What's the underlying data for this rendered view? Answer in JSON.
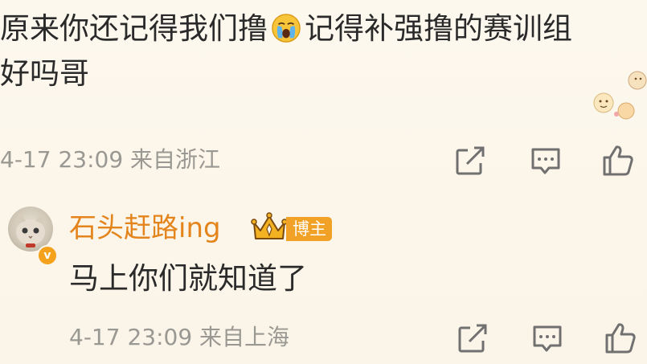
{
  "comment": {
    "line1_part1": "原来你还记得我们撸",
    "line1_part2": "记得补强撸的赛训组",
    "line2": "好吗哥",
    "emoji": "crying-face-icon"
  },
  "comment_meta": {
    "time_location": "4-17 23:09 来自浙江"
  },
  "reply": {
    "username": "石头赶路ing",
    "owner_badge": "博主",
    "verified_icon": "v-verified-icon",
    "text": "马上你们就知道了",
    "time_location": "4-17 23:09 来自上海"
  },
  "actions": [
    "share-icon",
    "comment-icon",
    "like-icon"
  ],
  "colors": {
    "background": "#fcf6ea",
    "username": "#e3841c",
    "meta_text": "#9a9892",
    "badge": "#f0a126",
    "icon": "#6e6e6e"
  }
}
